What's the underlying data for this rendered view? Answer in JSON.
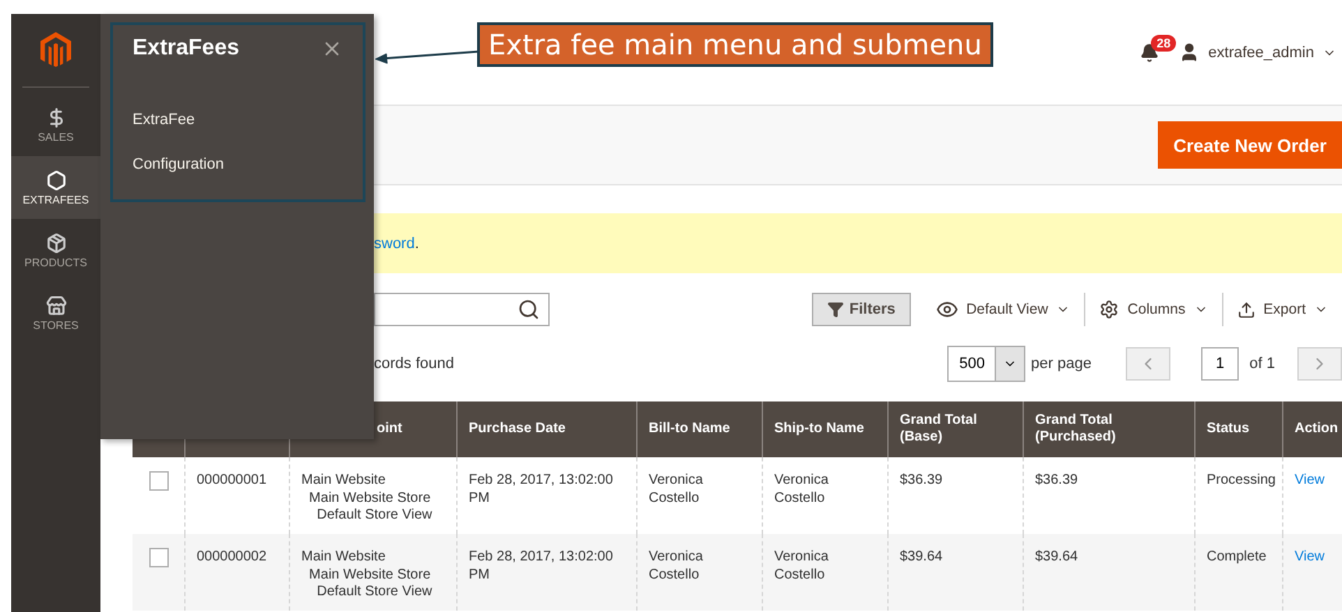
{
  "sidebar": {
    "items": [
      {
        "label": "SALES",
        "selected": false
      },
      {
        "label": "EXTRAFEES",
        "selected": true
      },
      {
        "label": "PRODUCTS",
        "selected": false
      },
      {
        "label": "STORES",
        "selected": false
      }
    ]
  },
  "flyout": {
    "title": "ExtraFees",
    "items": [
      "ExtraFee",
      "Configuration"
    ]
  },
  "callout": {
    "text": "Extra fee main menu and submenu"
  },
  "header": {
    "notifications": "28",
    "user": "extrafee_admin"
  },
  "page_actions": {
    "create_button": "Create New Order"
  },
  "notice": {
    "link": "sword",
    "after": "."
  },
  "toolbar": {
    "filters": "Filters",
    "view": "Default View",
    "columns": "Columns",
    "export": "Export",
    "records": "cords found",
    "per_page": "500",
    "per_page_label": "per page",
    "page": "1",
    "page_total": "of 1"
  },
  "table": {
    "columns": [
      "",
      "oint",
      "Purchase Date",
      "Bill-to Name",
      "Ship-to Name",
      "Grand Total\n(Base)",
      "Grand Total\n(Purchased)",
      "Status",
      "Action"
    ],
    "rows": [
      {
        "selected": false,
        "cells": [
          "000000001",
          "Main Website\n  Main Website Store\n    Default Store View",
          "Feb 28, 2017, 13:02:00\nPM",
          "Veronica\nCostello",
          "Veronica\nCostello",
          "$36.39",
          "$36.39",
          "Processing",
          "View"
        ]
      },
      {
        "selected": false,
        "cells": [
          "000000002",
          "Main Website\n  Main Website Store\n    Default Store View",
          "Feb 28, 2017, 13:02:00\nPM",
          "Veronica\nCostello",
          "Veronica\nCostello",
          "$39.64",
          "$39.64",
          "Complete",
          "View"
        ]
      }
    ]
  }
}
